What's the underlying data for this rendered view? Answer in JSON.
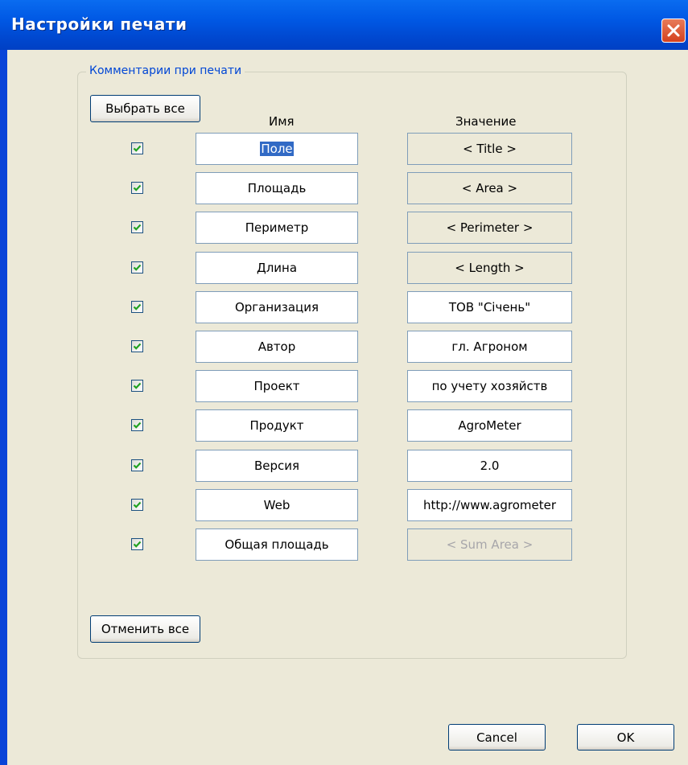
{
  "window": {
    "title": "Настройки печати"
  },
  "group": {
    "label": "Комментарии при печати"
  },
  "buttons": {
    "select_all": "Выбрать все",
    "deselect_all": "Отменить все",
    "cancel": "Cancel",
    "ok": "OK"
  },
  "columns": {
    "name": "Имя",
    "value": "Значение"
  },
  "rows": [
    {
      "checked": true,
      "name": "Поле",
      "value": "< Title >",
      "value_state": "readonly"
    },
    {
      "checked": true,
      "name": "Площадь",
      "value": "< Area >",
      "value_state": "readonly"
    },
    {
      "checked": true,
      "name": "Периметр",
      "value": "< Perimeter >",
      "value_state": "readonly"
    },
    {
      "checked": true,
      "name": "Длина",
      "value": "< Length >",
      "value_state": "readonly"
    },
    {
      "checked": true,
      "name": "Организация",
      "value": "ТОВ \"Січень\"",
      "value_state": "editable"
    },
    {
      "checked": true,
      "name": "Автор",
      "value": "гл. Агроном",
      "value_state": "editable"
    },
    {
      "checked": true,
      "name": "Проект",
      "value": "по учету хозяйств",
      "value_state": "editable"
    },
    {
      "checked": true,
      "name": "Продукт",
      "value": "AgroMeter",
      "value_state": "editable"
    },
    {
      "checked": true,
      "name": "Версия",
      "value": "2.0",
      "value_state": "editable"
    },
    {
      "checked": true,
      "name": "Web",
      "value": "http://www.agrometer",
      "value_state": "editable"
    },
    {
      "checked": true,
      "name": "Общая площадь",
      "value": "< Sum Area >",
      "value_state": "disabled"
    }
  ],
  "icons": {
    "close": "close-icon",
    "check": "checkmark-icon"
  },
  "colors": {
    "title_bar": "#0058e4",
    "client_bg": "#ece9d8",
    "group_label": "#0046d5",
    "check": "#21a121",
    "selection": "#316ac5"
  }
}
